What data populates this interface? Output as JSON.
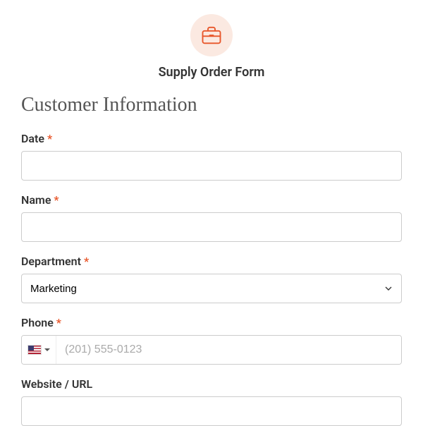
{
  "header": {
    "title": "Supply Order Form"
  },
  "section": {
    "title": "Customer Information"
  },
  "fields": {
    "date": {
      "label": "Date",
      "required": "*",
      "value": ""
    },
    "name": {
      "label": "Name",
      "required": "*",
      "value": ""
    },
    "department": {
      "label": "Department",
      "required": "*",
      "selected": "Marketing"
    },
    "phone": {
      "label": "Phone",
      "required": "*",
      "placeholder": "(201) 555-0123",
      "value": ""
    },
    "website": {
      "label": "Website / URL",
      "value": ""
    }
  }
}
